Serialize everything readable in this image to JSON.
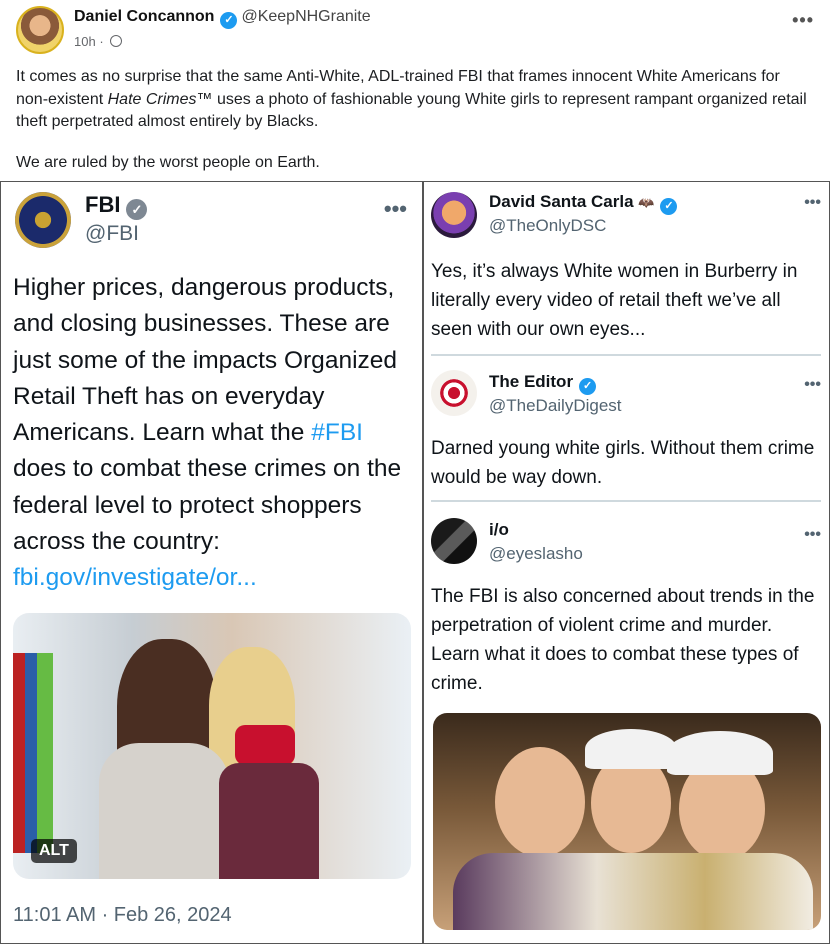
{
  "post": {
    "author": "Daniel Concannon",
    "handle": "@KeepNHGranite",
    "time": "10h",
    "dot": "·",
    "more": "•••",
    "text_p1_a": "It comes as no surprise that the same Anti-White, ADL-trained FBI that frames innocent White Americans for non-existent ",
    "text_p1_em": "Hate Crimes",
    "text_p1_b": "™ uses a photo of fashionable young White girls to represent rampant organized retail theft perpetrated almost entirely by Blacks.",
    "text_p2": "We are ruled by the worst people on Earth."
  },
  "left_tweet": {
    "name": "FBI",
    "handle": "@FBI",
    "more": "•••",
    "text_a": "Higher prices, dangerous products, and closing businesses. These are just some of the impacts Organized Retail Theft has on everyday Americans. Learn what the ",
    "hashtag": "#FBI",
    "text_b": " does to combat these crimes on the federal level to protect shoppers across the country: ",
    "link": "fbi.gov/investigate/or...",
    "alt": "ALT",
    "timestamp": "11:01 AM · Feb 26, 2024"
  },
  "replies": [
    {
      "name": "David Santa Carla",
      "handle": "@TheOnlyDSC",
      "more": "•••",
      "text": "Yes, it’s always White women in Burberry in literally every video of retail theft we’ve all seen with our own eyes..."
    },
    {
      "name": "The Editor",
      "handle": "@TheDailyDigest",
      "more": "•••",
      "text": "Darned young white girls.  Without them crime would be way down."
    },
    {
      "name": "i/o",
      "handle": "@eyeslasho",
      "more": "•••",
      "text": "The FBI is also concerned about trends in the perpetration of violent crime and murder. Learn what it does to combat these types of crime."
    }
  ],
  "icons": {
    "verified": "verified-check-icon",
    "globe": "globe-icon",
    "more": "more-dots-icon",
    "bat": "bat-emoji"
  },
  "colors": {
    "link": "#1d9bf0",
    "verified": "#1d9bf0",
    "fbi_verified": "#7e8893"
  }
}
